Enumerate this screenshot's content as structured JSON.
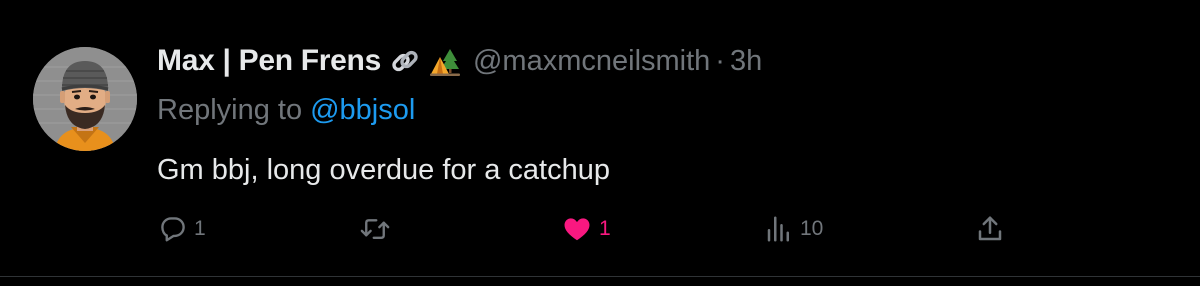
{
  "tweet": {
    "author": {
      "display_name": "Max | Pen Frens",
      "badges": [
        "link-emoji",
        "camping-emoji"
      ],
      "handle": "@maxmcneilsmith",
      "separator": "·",
      "time": "3h"
    },
    "replying_to": {
      "prefix": "Replying to",
      "mention": "@bbjsol"
    },
    "text": "Gm bbj, long overdue for a catchup",
    "actions": {
      "reply_count": "1",
      "retweet_count": "",
      "like_count": "1",
      "liked": true,
      "view_count": "10"
    }
  },
  "colors": {
    "background": "#000000",
    "primary_text": "#e7e9ea",
    "secondary_text": "#71767b",
    "link": "#1d9bf0",
    "like": "#f91880",
    "divider": "#2f3336"
  },
  "icons": {
    "reply": "reply-bubble-icon",
    "retweet": "retweet-icon",
    "like": "heart-icon",
    "views": "views-bar-chart-icon",
    "share": "share-upload-icon"
  }
}
